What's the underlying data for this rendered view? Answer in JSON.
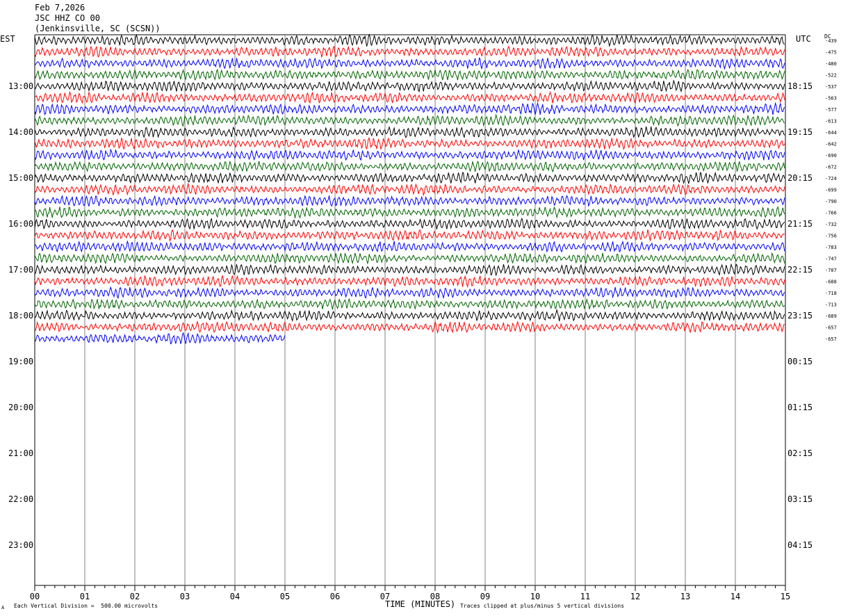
{
  "header": {
    "date": "Feb 7,2026",
    "channel": "JSC HHZ CO 00",
    "location": "(Jenkinsville, SC (SCSN))"
  },
  "left_timezone": "EST",
  "right_timezone": "UTC",
  "dc_label": "DC",
  "footer": {
    "division_note": "Each Vertical Division =  500.00 microvolts",
    "clip_note": "Traces clipped at plus/minus 5 vertical divisions",
    "corner_mark": "A"
  },
  "colors": {
    "black": "#000000",
    "red": "#ff0000",
    "blue": "#0000ff",
    "green": "#006400",
    "grid": "#808080"
  },
  "chart_data": {
    "type": "line",
    "subtype": "helicorder",
    "xlabel": "TIME (MINUTES)",
    "x_range": [
      0,
      15
    ],
    "x_tick_labels": [
      "00",
      "01",
      "02",
      "03",
      "04",
      "05",
      "06",
      "07",
      "08",
      "09",
      "10",
      "11",
      "12",
      "13",
      "14",
      "15"
    ],
    "rows_per_hour": 4,
    "left_hour_labels": [
      "13:00",
      "14:00",
      "15:00",
      "16:00",
      "17:00",
      "18:00",
      "19:00",
      "20:00",
      "21:00",
      "22:00",
      "23:00"
    ],
    "right_hour_labels": [
      "18:15",
      "19:15",
      "20:15",
      "21:15",
      "22:15",
      "23:15",
      "00:15",
      "01:15",
      "02:15",
      "03:15",
      "04:15"
    ],
    "trace_color_cycle": [
      "black",
      "red",
      "blue",
      "green"
    ],
    "dc_offsets": [
      "-439",
      "-475",
      "-480",
      "-522",
      "-537",
      "-563",
      "-577",
      "-613",
      "-644",
      "-642",
      "-690",
      "-672",
      "-724",
      "-699",
      "-790",
      "-766",
      "-732",
      "-756",
      "-783",
      "-747",
      "-707",
      "-688",
      "-718",
      "-713",
      "-689",
      "-657",
      "-657"
    ],
    "last_trace_end_minute": 5.0
  }
}
